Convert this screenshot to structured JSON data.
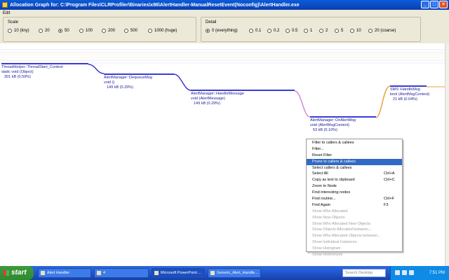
{
  "window": {
    "title": "Allocation Graph for: C:\\Program Files\\CLRProfiler\\Binaries\\x86\\AlertHandler-ManualResetEvent(Noconfig)\\AlertHandler.exe"
  },
  "menu": {
    "edit": "Edit"
  },
  "scale": {
    "label": "Scale",
    "options": [
      "10 (tiny)",
      "20",
      "50",
      "100",
      "200",
      "500",
      "1000 (huge)"
    ],
    "selected": "50"
  },
  "detail": {
    "label": "Detail",
    "options": [
      "0 (everything)",
      "0.1",
      "0.2",
      "0.5",
      "1",
      "2",
      "5",
      "10",
      "20 (coarse)"
    ],
    "selected": "0 (everything)"
  },
  "nodes": [
    {
      "name": "ThreadHelper::ThreadStart_Context",
      "sig": "static void (Object)",
      "size": "301 kB    (0.59%)"
    },
    {
      "name": "AlertManager::DequeueMsg",
      "sig": "void ()",
      "size": "149 kB    (0.29%)"
    },
    {
      "name": "AlertManager::HandleMessage",
      "sig": "void (AlertMessage)",
      "size": "149 kB    (0.29%)"
    },
    {
      "name": "AlertManager::OnAlertMsg",
      "sig": "void (AlertMsgContext)",
      "size": "53 kB    (0.10%)"
    },
    {
      "name": "SMS::HandleMsg",
      "sig": "bool (AlertMsgContext)",
      "size": "21 kB    (0.04%)"
    }
  ],
  "context_menu": [
    {
      "label": "Filter to callers & callees",
      "shortcut": "",
      "disabled": false
    },
    {
      "label": "Filter...",
      "shortcut": "",
      "disabled": false
    },
    {
      "label": "Reset Filter",
      "shortcut": "",
      "disabled": false
    },
    {
      "label": "Prune to callers & callees",
      "shortcut": "",
      "disabled": false,
      "highlighted": true
    },
    {
      "label": "Select callers & callees",
      "shortcut": "",
      "disabled": false
    },
    {
      "label": "Select All",
      "shortcut": "Ctrl+A",
      "disabled": false
    },
    {
      "label": "Copy as text to clipboard",
      "shortcut": "Ctrl+C",
      "disabled": false
    },
    {
      "label": "Zoom to Node",
      "shortcut": "",
      "disabled": false
    },
    {
      "label": "Find interesting nodes",
      "shortcut": "",
      "disabled": false
    },
    {
      "label": "Find routine...",
      "shortcut": "Ctrl+F",
      "disabled": false
    },
    {
      "label": "Find Again",
      "shortcut": "F3",
      "disabled": false
    },
    {
      "label": "Show Who Allocated",
      "shortcut": "",
      "disabled": true
    },
    {
      "label": "Show New Objects",
      "shortcut": "",
      "disabled": true
    },
    {
      "label": "Show Who Allocated New Objects",
      "shortcut": "",
      "disabled": true
    },
    {
      "label": "Show Objects Allocated between...",
      "shortcut": "",
      "disabled": true
    },
    {
      "label": "Show Who Allocated Objects between...",
      "shortcut": "",
      "disabled": true
    },
    {
      "label": "Show Individual Instances",
      "shortcut": "",
      "disabled": true
    },
    {
      "label": "Show Histogram",
      "shortcut": "",
      "disabled": true
    },
    {
      "label": "Show References",
      "shortcut": "",
      "disabled": true
    }
  ],
  "taskbar": {
    "start": "start",
    "buttons": [
      "Alert Handler",
      "4",
      "Microsoft PowerPoint ...",
      "Generic_Alert_Handle..."
    ],
    "search_placeholder": "Search Desktop",
    "clock": "7:51 PM"
  },
  "colors": {
    "title_blue": "#0a5ed8",
    "node_bar": "#3b3bd6",
    "menu_highlight": "#316ac5"
  }
}
